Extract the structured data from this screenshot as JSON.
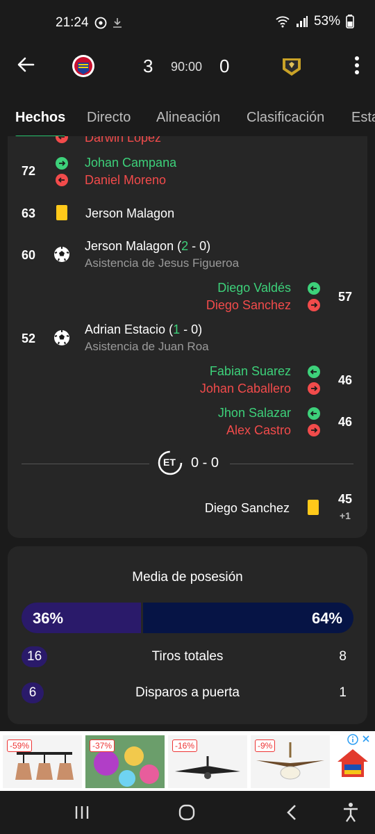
{
  "status_bar": {
    "time": "21:24",
    "battery": "53%"
  },
  "match": {
    "home_score": "3",
    "away_score": "0",
    "clock": "90:00"
  },
  "tabs": [
    {
      "label": "Hechos",
      "active": true
    },
    {
      "label": "Directo",
      "active": false
    },
    {
      "label": "Alineación",
      "active": false
    },
    {
      "label": "Clasificación",
      "active": false
    },
    {
      "label": "Esta",
      "active": false
    }
  ],
  "events": {
    "cut_off_name": "Darwin Lopez",
    "e72": {
      "minute": "72",
      "in": "Johan Campana",
      "out": "Daniel Moreno"
    },
    "e63": {
      "minute": "63",
      "player": "Jerson Malagon"
    },
    "e60": {
      "minute": "60",
      "player": "Jerson Malagon",
      "score_open": " (",
      "score_hl": "2",
      "score_rest": " - 0)",
      "assist": "Asistencia de Jesus Figueroa"
    },
    "e57": {
      "minute": "57",
      "in": "Diego Valdés",
      "out": "Diego Sanchez"
    },
    "e52": {
      "minute": "52",
      "player": "Adrian Estacio",
      "score_open": " (",
      "score_hl": "1",
      "score_rest": " - 0)",
      "assist": "Asistencia de Juan Roa"
    },
    "e46a": {
      "minute": "46",
      "in": "Fabian Suarez",
      "out": "Johan Caballero"
    },
    "e46b": {
      "minute": "46",
      "in": "Jhon Salazar",
      "out": "Alex Castro"
    },
    "halftime": {
      "badge": "ET",
      "score": "0 - 0"
    },
    "e45": {
      "minute": "45",
      "extra": "+1",
      "player": "Diego Sanchez"
    }
  },
  "stats": {
    "title": "Media de posesión",
    "possession_home": "36%",
    "possession_away": "64%",
    "possession_home_value": 36,
    "rows": [
      {
        "label": "Tiros totales",
        "home": "16",
        "away": "8"
      },
      {
        "label": "Disparos a puerta",
        "home": "6",
        "away": "1"
      }
    ]
  },
  "ad": {
    "discounts": [
      "-59%",
      "-37%",
      "-16%",
      "-9%"
    ]
  },
  "colors": {
    "accent": "#27c46e",
    "sub_in": "#3dd17a",
    "sub_out": "#f24b4b",
    "yellow_card": "#ffc91a",
    "possession_home": "#2a1a6a",
    "possession_away": "#061445"
  }
}
